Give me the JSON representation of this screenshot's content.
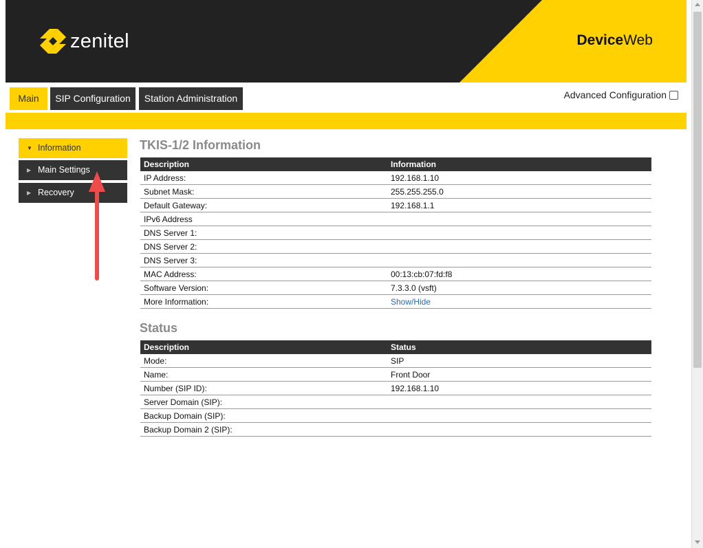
{
  "header": {
    "logo_text": "zenitel",
    "brand_bold": "Device",
    "brand_light": "Web",
    "accent_color": "#FFD100",
    "dark_color": "#222222"
  },
  "tabs": [
    {
      "label": "Main",
      "active": true
    },
    {
      "label": "SIP Configuration",
      "active": false
    },
    {
      "label": "Station Administration",
      "active": false
    }
  ],
  "advanced": {
    "label": "Advanced Configuration",
    "checked": false
  },
  "sidebar": {
    "items": [
      {
        "label": "Information",
        "active": true
      },
      {
        "label": "Main Settings",
        "active": false
      },
      {
        "label": "Recovery",
        "active": false
      }
    ]
  },
  "info_section": {
    "title": "TKIS-1/2 Information",
    "headers": [
      "Description",
      "Information"
    ],
    "rows": [
      {
        "k": "IP Address:",
        "v": "192.168.1.10"
      },
      {
        "k": "Subnet Mask:",
        "v": "255.255.255.0"
      },
      {
        "k": "Default Gateway:",
        "v": "192.168.1.1"
      },
      {
        "k": "IPv6 Address",
        "v": ""
      },
      {
        "k": "DNS Server 1:",
        "v": ""
      },
      {
        "k": "DNS Server 2:",
        "v": ""
      },
      {
        "k": "DNS Server 3:",
        "v": ""
      },
      {
        "k": "MAC Address:",
        "v": "00:13:cb:07:fd:f8"
      },
      {
        "k": "Software Version:",
        "v": "7.3.3.0 (vsft)"
      },
      {
        "k": "More Information:",
        "v": "Show/Hide"
      }
    ]
  },
  "status_section": {
    "title": "Status",
    "headers": [
      "Description",
      "Status"
    ],
    "rows": [
      {
        "k": "Mode:",
        "v": "SIP"
      },
      {
        "k": "Name:",
        "v": "Front Door"
      },
      {
        "k": "Number (SIP ID):",
        "v": "192.168.1.10"
      },
      {
        "k": "Server Domain (SIP):",
        "v": ""
      },
      {
        "k": "Backup Domain (SIP):",
        "v": ""
      },
      {
        "k": "Backup Domain 2 (SIP):",
        "v": ""
      }
    ]
  },
  "annotation": {
    "color": "#EE4B4B"
  }
}
